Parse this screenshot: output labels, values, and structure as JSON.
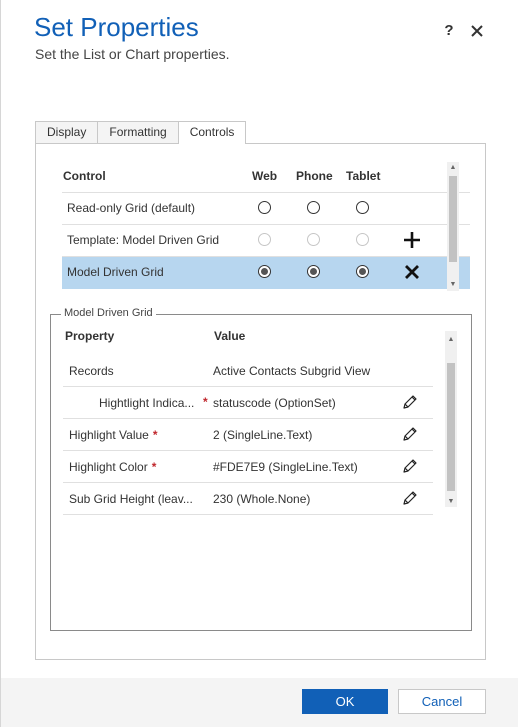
{
  "dialog": {
    "title": "Set Properties",
    "subtitle": "Set the List or Chart properties.",
    "help_label": "?"
  },
  "tabs": [
    {
      "label": "Display",
      "active": false
    },
    {
      "label": "Formatting",
      "active": false
    },
    {
      "label": "Controls",
      "active": true
    }
  ],
  "controls": {
    "headers": {
      "control": "Control",
      "web": "Web",
      "phone": "Phone",
      "tablet": "Tablet"
    },
    "rows": [
      {
        "label": "Read-only Grid (default)",
        "web": "unchecked",
        "phone": "unchecked",
        "tablet": "unchecked",
        "action": "none"
      },
      {
        "label": "Template: Model Driven Grid",
        "web": "disabled",
        "phone": "disabled",
        "tablet": "disabled",
        "action": "plus-icon"
      },
      {
        "label": "Model Driven Grid",
        "web": "checked",
        "phone": "checked",
        "tablet": "checked",
        "action": "x-icon",
        "selected": true
      }
    ]
  },
  "properties": {
    "group_title": "Model Driven Grid",
    "headers": {
      "property": "Property",
      "value": "Value"
    },
    "rows": [
      {
        "label": "Records",
        "value": "Active Contacts Subgrid View",
        "required": false,
        "editable": false
      },
      {
        "label": "Hightlight Indica...",
        "value": "statuscode (OptionSet)",
        "required": true,
        "editable": true
      },
      {
        "label": "Highlight Value",
        "value": "2 (SingleLine.Text)",
        "required": true,
        "editable": true
      },
      {
        "label": "Highlight Color",
        "value": "#FDE7E9 (SingleLine.Text)",
        "required": true,
        "editable": true
      },
      {
        "label": "Sub Grid Height (leav...",
        "value": "230 (Whole.None)",
        "required": false,
        "editable": true
      }
    ],
    "required_mark": "*"
  },
  "footer": {
    "ok_label": "OK",
    "cancel_label": "Cancel"
  },
  "colors": {
    "accent": "#1160b7",
    "selected_row": "#b7d6ef",
    "required": "#c0272d"
  }
}
